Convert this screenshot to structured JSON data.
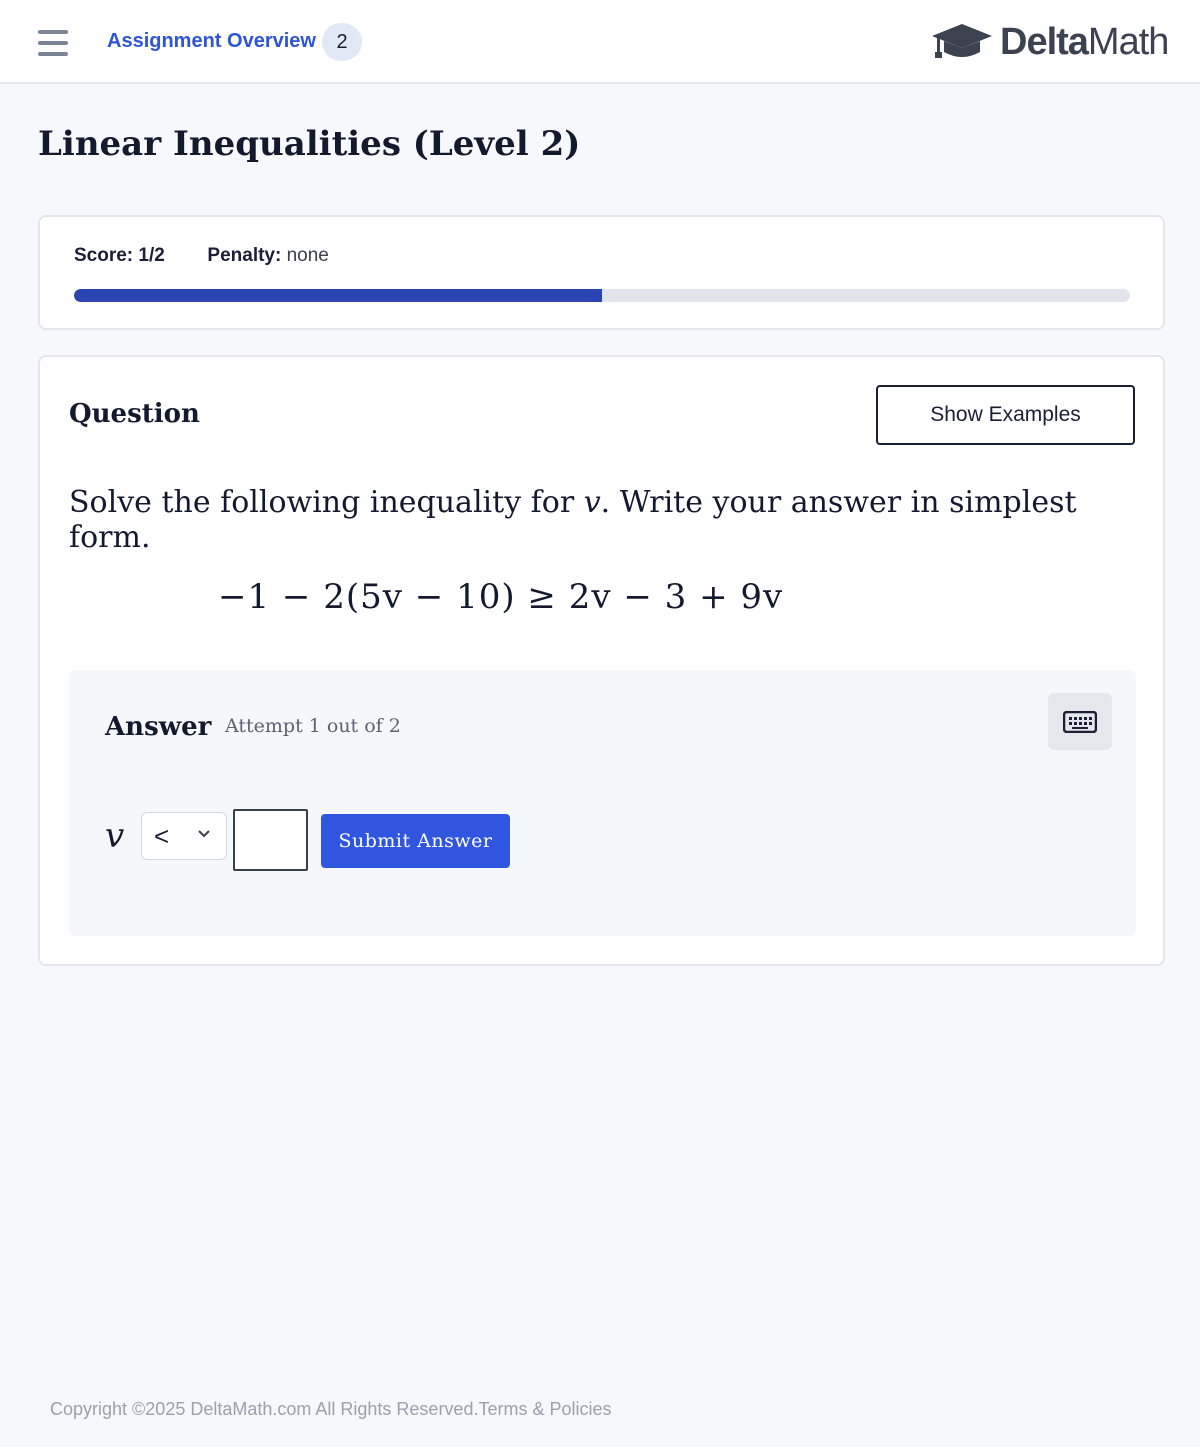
{
  "header": {
    "nav_link": "Assignment Overview",
    "nav_badge": "2",
    "logo_bold": "Delta",
    "logo_light": "Math",
    "icons": [
      "hamburger-menu-icon",
      "graduation-cap-icon"
    ]
  },
  "page": {
    "title": "Linear Inequalities (Level 2)"
  },
  "score": {
    "score_label": "Score:",
    "score_value": "1/2",
    "penalty_label": "Penalty:",
    "penalty_value": "none",
    "progress_fraction": 0.5
  },
  "question": {
    "heading": "Question",
    "show_examples": "Show Examples",
    "prompt_before": "Solve the following inequality for ",
    "prompt_var": "v",
    "prompt_after": ". Write your answer in simplest form.",
    "equation": "−1 − 2(5v − 10) ≥ 2v − 3 + 9v"
  },
  "answer": {
    "label": "Answer",
    "attempt": "Attempt 1 out of 2",
    "variable": "v",
    "selected_inequality": "<",
    "input_value": "",
    "submit_label": "Submit Answer",
    "keyboard_icon": "keyboard-icon"
  },
  "footer": {
    "copyright": "Copyright ©2025 DeltaMath.com All Rights Reserved.",
    "terms": "Terms & Policies"
  },
  "colors": {
    "accent": "#2f55d4",
    "progress": "#2a44b3",
    "submit": "#3056e0"
  }
}
